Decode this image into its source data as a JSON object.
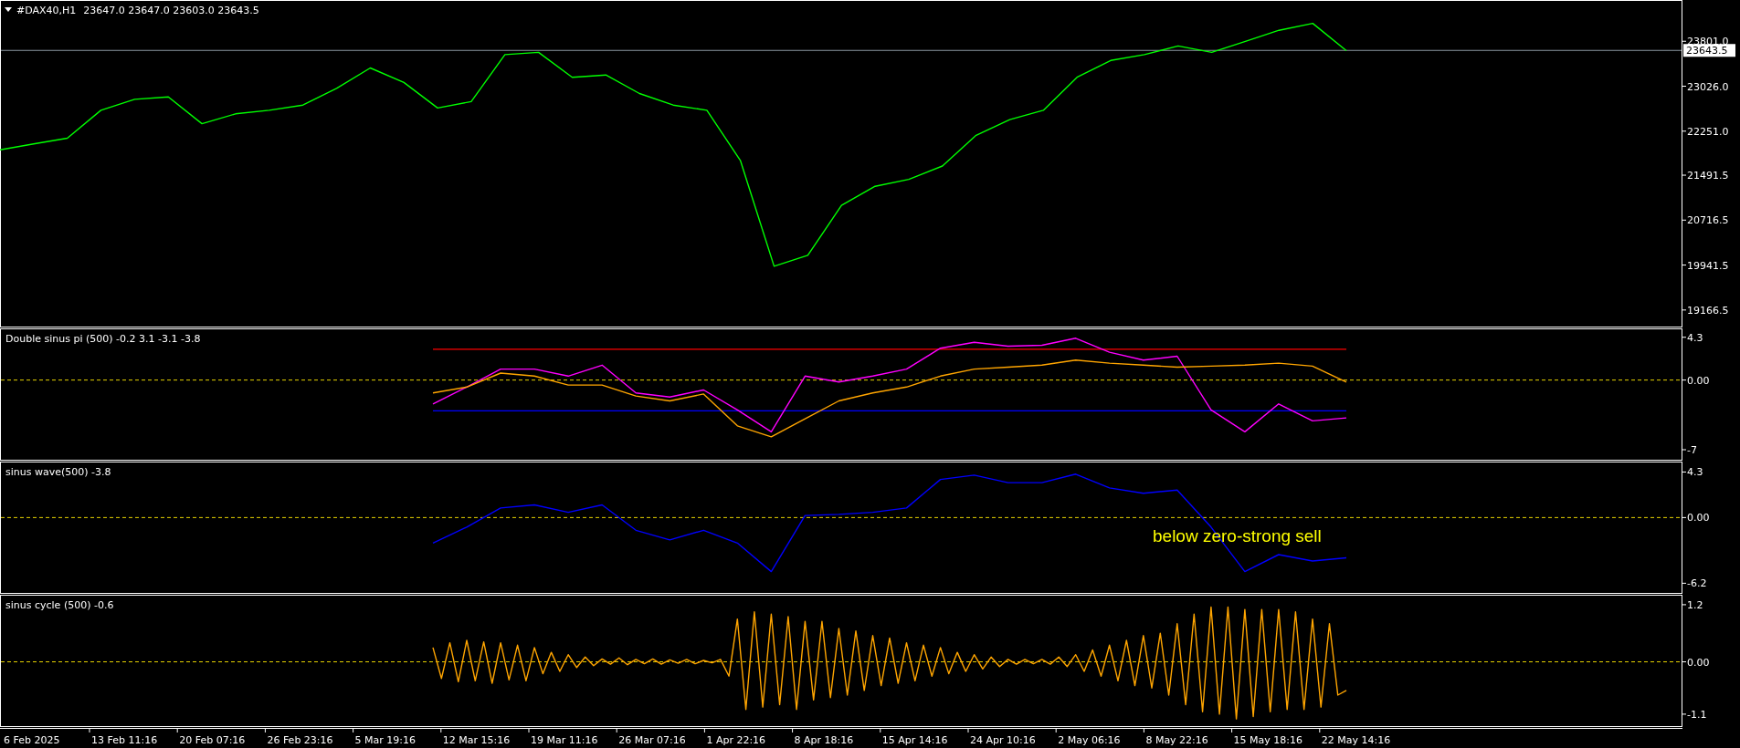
{
  "panes": [
    {
      "title": "#DAX40,H1",
      "quote": "23647.0 23647.0 23603.0 23643.5",
      "chart_data": {
        "type": "line",
        "ylim": [
          18865,
          24497
        ],
        "yticks": [
          {
            "value": 23801,
            "label": "23801.0"
          },
          {
            "value": 23026,
            "label": "23026.0"
          },
          {
            "value": 22251,
            "label": "22251.0"
          },
          {
            "value": 21491.5,
            "label": "21491.5"
          },
          {
            "value": 20716.5,
            "label": "20716.5"
          },
          {
            "value": 19941.5,
            "label": "19941.5"
          },
          {
            "value": 19166.5,
            "label": "19166.5"
          }
        ],
        "series": [
          {
            "color": "#00ff00",
            "values": [
              21930,
              22030,
              22130,
              22610,
              22800,
              22840,
              22380,
              22550,
              22610,
              22700,
              22990,
              23340,
              23090,
              22650,
              22760,
              23570,
              23610,
              23180,
              23220,
              22900,
              22700,
              22610,
              21740,
              19920,
              20110,
              20970,
              21300,
              21420,
              21650,
              22180,
              22450,
              22610,
              23180,
              23470,
              23570,
              23720,
              23610,
              23800,
              23990,
              24110,
              23640
            ]
          }
        ],
        "ref_lines": [
          {
            "axis": "y",
            "value": 23643.5,
            "label": "23643.5",
            "color": "#8a96a0"
          }
        ]
      }
    },
    {
      "title": "Double sinus pi (500) -0.2 3.1 -3.1 -3.8",
      "chart_data": {
        "type": "line",
        "ylim": [
          -8.1,
          5.1
        ],
        "yticks": [
          {
            "value": 4.3,
            "label": "4.3"
          },
          {
            "value": 0,
            "label": "0.00"
          },
          {
            "value": -7,
            "label": "-7"
          }
        ],
        "series": [
          {
            "color": "#ff00ff",
            "values": [
              -2.4,
              -0.7,
              1.1,
              1.1,
              0.4,
              1.5,
              -1.3,
              -1.7,
              -1.0,
              -3.0,
              -5.2,
              0.4,
              -0.2,
              0.4,
              1.1,
              3.2,
              3.8,
              3.4,
              3.5,
              4.2,
              2.8,
              2.0,
              2.4,
              -3.0,
              -5.2,
              -2.4,
              -4.1,
              -3.8
            ]
          },
          {
            "color": "#ffa500",
            "values": [
              -1.3,
              -0.7,
              0.7,
              0.4,
              -0.5,
              -0.5,
              -1.6,
              -2.1,
              -1.4,
              -4.6,
              -5.7,
              -3.9,
              -2.1,
              -1.3,
              -0.7,
              0.4,
              1.1,
              1.3,
              1.5,
              2.0,
              1.7,
              1.5,
              1.3,
              1.4,
              1.5,
              1.7,
              1.4,
              -0.2
            ]
          }
        ],
        "ref_lines": [
          {
            "axis": "y",
            "value": 3.1,
            "color": "#ff0000"
          },
          {
            "axis": "y",
            "value": -3.1,
            "color": "#0000ff"
          },
          {
            "axis": "y",
            "value": 0,
            "color": "#e6d200"
          }
        ]
      }
    },
    {
      "title": "sinus wave(500) -3.8",
      "chart_data": {
        "type": "line",
        "ylim": [
          -7.2,
          5.2
        ],
        "yticks": [
          {
            "value": 4.3,
            "label": "4.3"
          },
          {
            "value": 0,
            "label": "0.00"
          },
          {
            "value": -6.2,
            "label": "-6.2"
          }
        ],
        "series": [
          {
            "color": "#0000ff",
            "values": [
              -2.4,
              -0.9,
              0.9,
              1.2,
              0.5,
              1.2,
              -1.2,
              -2.1,
              -1.2,
              -2.4,
              -5.1,
              0.2,
              0.3,
              0.5,
              0.9,
              3.6,
              4.0,
              3.3,
              3.3,
              4.1,
              2.8,
              2.3,
              2.6,
              -0.9,
              -5.1,
              -3.5,
              -4.1,
              -3.8
            ]
          }
        ],
        "ref_lines": [
          {
            "axis": "y",
            "value": 0,
            "color": "#e6d200"
          }
        ],
        "annotations": [
          "below zero-strong sell"
        ]
      }
    },
    {
      "title": "sinus cycle (500) -0.6",
      "chart_data": {
        "type": "line",
        "ylim": [
          -1.37,
          1.39
        ],
        "yticks": [
          {
            "value": 1.2,
            "label": "1.2"
          },
          {
            "value": 0,
            "label": "0.00"
          },
          {
            "value": -1.1,
            "label": "-1.1"
          }
        ],
        "series": [
          {
            "color": "#ffa500",
            "values": [
              0.3,
              -0.35,
              0.4,
              -0.42,
              0.45,
              -0.4,
              0.42,
              -0.45,
              0.4,
              -0.38,
              0.35,
              -0.4,
              0.3,
              -0.25,
              0.2,
              -0.2,
              0.15,
              -0.12,
              0.1,
              -0.08,
              0.06,
              -0.05,
              0.08,
              -0.06,
              0.05,
              -0.04,
              0.06,
              -0.05,
              0.04,
              -0.03,
              0.05,
              -0.04,
              0.03,
              -0.02,
              0.05,
              -0.3,
              0.9,
              -1.0,
              1.05,
              -0.95,
              1.0,
              -0.9,
              0.95,
              -1.0,
              0.85,
              -0.8,
              0.85,
              -0.75,
              0.7,
              -0.7,
              0.65,
              -0.6,
              0.55,
              -0.5,
              0.5,
              -0.45,
              0.4,
              -0.4,
              0.35,
              -0.3,
              0.3,
              -0.25,
              0.2,
              -0.2,
              0.15,
              -0.15,
              0.1,
              -0.1,
              0.05,
              -0.05,
              0.05,
              -0.04,
              0.05,
              -0.05,
              0.1,
              -0.1,
              0.15,
              -0.2,
              0.25,
              -0.3,
              0.35,
              -0.4,
              0.45,
              -0.5,
              0.55,
              -0.55,
              0.6,
              -0.7,
              0.8,
              -0.9,
              1.0,
              -1.05,
              1.15,
              -1.1,
              1.15,
              -1.2,
              1.1,
              -1.15,
              1.1,
              -1.05,
              1.1,
              -1.0,
              1.05,
              -1.0,
              0.9,
              -0.95,
              0.8,
              -0.7,
              -0.6
            ]
          }
        ],
        "ref_lines": [
          {
            "axis": "y",
            "value": 0,
            "color": "#e6d200"
          }
        ]
      }
    }
  ],
  "time_axis": [
    "6 Feb 2025",
    "13 Feb 11:16",
    "20 Feb 07:16",
    "26 Feb 23:16",
    "5 Mar 19:16",
    "12 Mar 15:16",
    "19 Mar 11:16",
    "26 Mar 07:16",
    "1 Apr 22:16",
    "8 Apr 18:16",
    "15 Apr 14:16",
    "24 Apr 10:16",
    "2 May 06:16",
    "8 May 22:16",
    "15 May 18:16",
    "22 May 14:16"
  ]
}
